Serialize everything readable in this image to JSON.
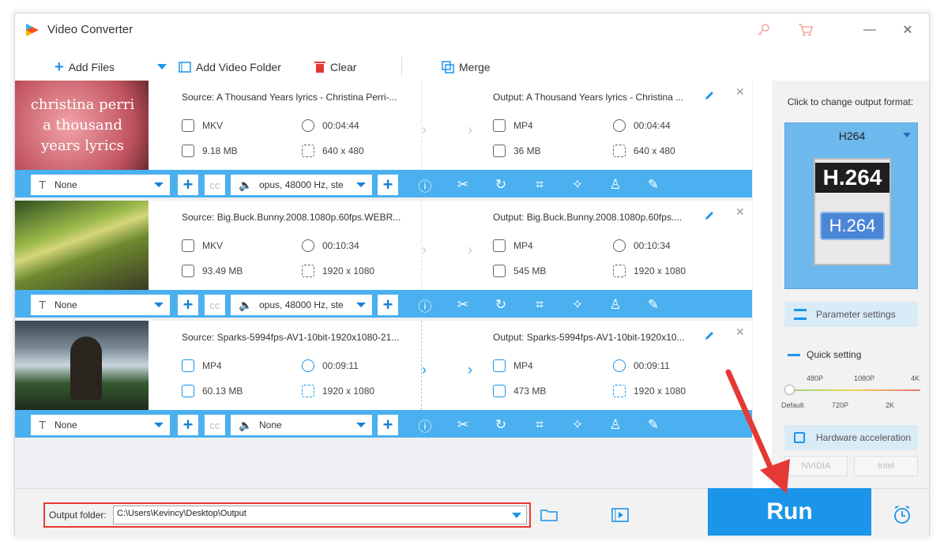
{
  "app": {
    "title": "Video Converter"
  },
  "toolbar": {
    "add_files": "Add Files",
    "add_folder": "Add Video Folder",
    "clear": "Clear",
    "merge": "Merge"
  },
  "items": [
    {
      "source": "Source: A Thousand Years lyrics - Christina Perri-...",
      "output": "Output: A Thousand Years lyrics - Christina ...",
      "src_format": "MKV",
      "src_duration": "00:04:44",
      "src_size": "9.18 MB",
      "src_res": "640 x 480",
      "out_format": "MP4",
      "out_duration": "00:04:44",
      "out_size": "36 MB",
      "out_res": "640 x 480",
      "subtitle": "None",
      "audio": "opus, 48000 Hz, ste",
      "thumb_text": "christina perri\na thousand\nyears lyrics"
    },
    {
      "source": "Source: Big.Buck.Bunny.2008.1080p.60fps.WEBR...",
      "output": "Output: Big.Buck.Bunny.2008.1080p.60fps....",
      "src_format": "MKV",
      "src_duration": "00:10:34",
      "src_size": "93.49 MB",
      "src_res": "1920 x 1080",
      "out_format": "MP4",
      "out_duration": "00:10:34",
      "out_size": "545 MB",
      "out_res": "1920 x 1080",
      "subtitle": "None",
      "audio": "opus, 48000 Hz, ste"
    },
    {
      "source": "Source: Sparks-5994fps-AV1-10bit-1920x1080-21...",
      "output": "Output: Sparks-5994fps-AV1-10bit-1920x10...",
      "src_format": "MP4",
      "src_duration": "00:09:11",
      "src_size": "60.13 MB",
      "src_res": "1920 x 1080",
      "out_format": "MP4",
      "out_duration": "00:09:11",
      "out_size": "473 MB",
      "out_res": "1920 x 1080",
      "subtitle": "None",
      "audio": "None"
    }
  ],
  "side": {
    "click_hint": "Click to change output format:",
    "format": "H264",
    "badge_top": "H.264",
    "badge_bottom": "H.264",
    "param": "Parameter settings",
    "quick": "Quick setting",
    "q_top": [
      "480P",
      "1080P",
      "4K"
    ],
    "q_bottom": [
      "Default",
      "720P",
      "2K"
    ],
    "hw": "Hardware acceleration",
    "nvidia": "NVIDIA",
    "intel": "Intel"
  },
  "footer": {
    "label": "Output folder:",
    "path": "C:\\Users\\Kevincy\\Desktop\\Output",
    "run": "Run"
  },
  "colors": {
    "accent": "#1b95ea",
    "bar": "#4ab0ef",
    "highlight": "#e53935"
  }
}
